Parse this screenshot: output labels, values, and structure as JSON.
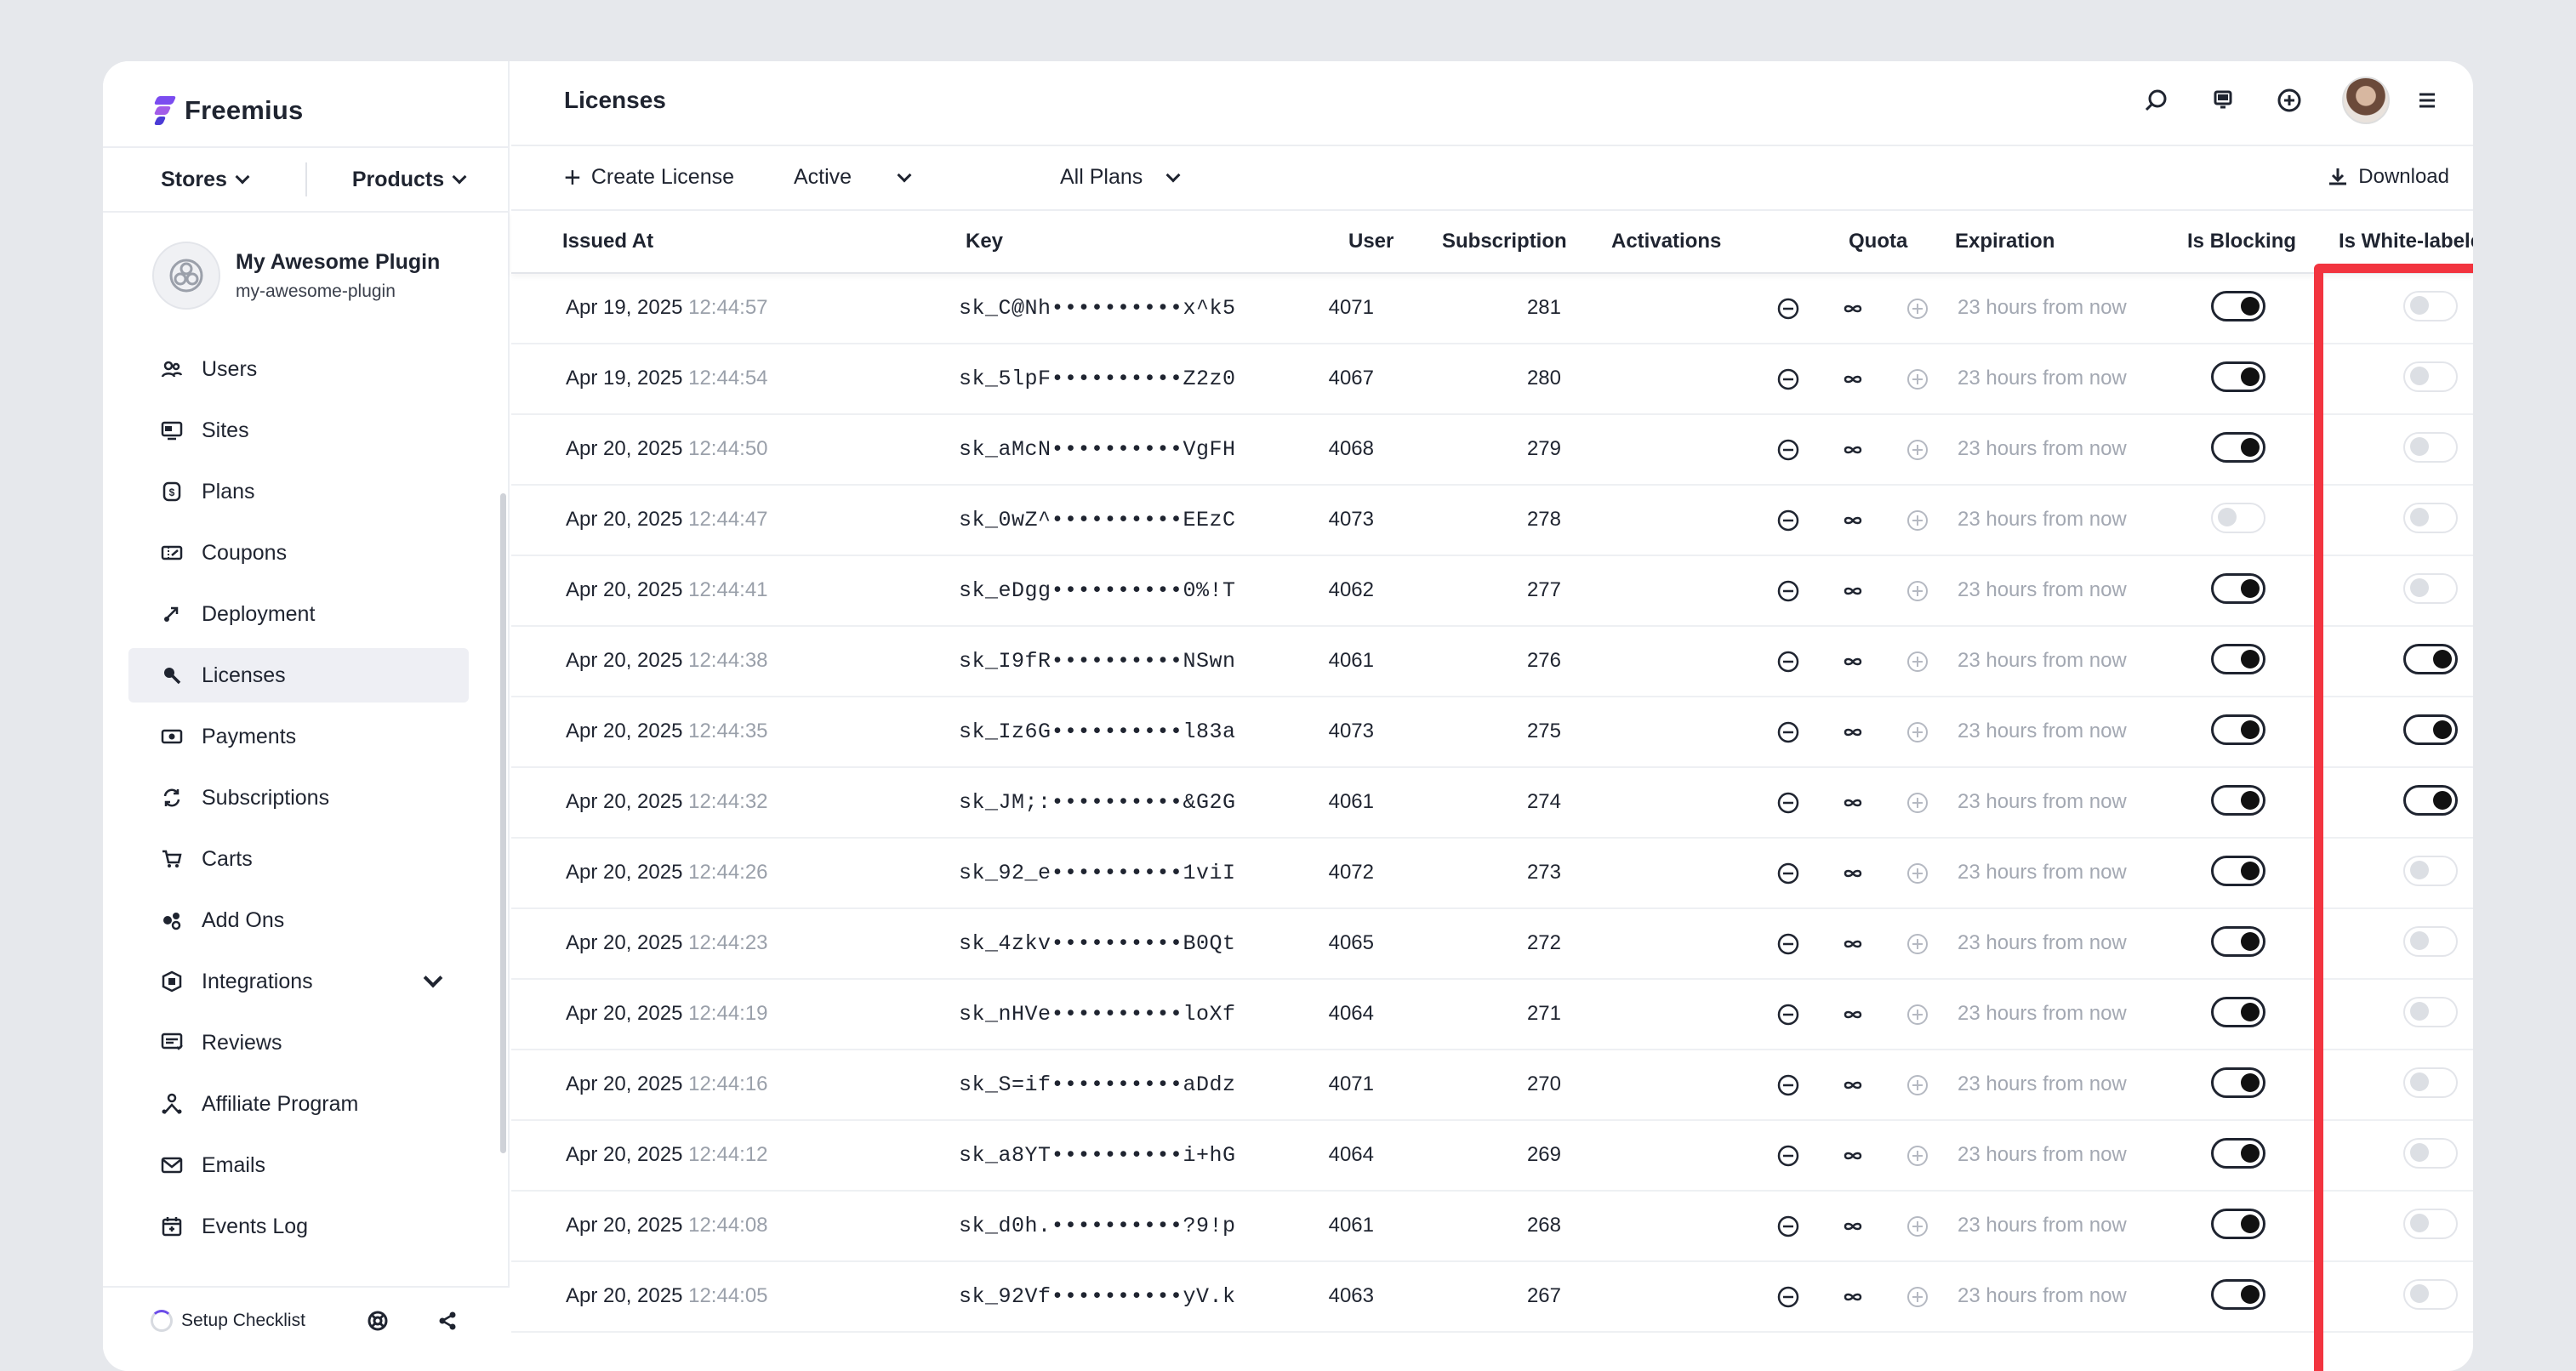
{
  "brand": {
    "name": "Freemius"
  },
  "switcher": {
    "stores": "Stores",
    "products": "Products"
  },
  "plugin": {
    "name": "My Awesome Plugin",
    "slug": "my-awesome-plugin"
  },
  "nav": {
    "items": [
      {
        "label": "Users",
        "icon": "users-icon"
      },
      {
        "label": "Sites",
        "icon": "sites-icon"
      },
      {
        "label": "Plans",
        "icon": "plans-icon"
      },
      {
        "label": "Coupons",
        "icon": "coupons-icon"
      },
      {
        "label": "Deployment",
        "icon": "deployment-icon"
      },
      {
        "label": "Licenses",
        "icon": "licenses-icon",
        "active": true
      },
      {
        "label": "Payments",
        "icon": "payments-icon"
      },
      {
        "label": "Subscriptions",
        "icon": "subscriptions-icon"
      },
      {
        "label": "Carts",
        "icon": "carts-icon"
      },
      {
        "label": "Add Ons",
        "icon": "addons-icon"
      },
      {
        "label": "Integrations",
        "icon": "integrations-icon",
        "expandable": true
      },
      {
        "label": "Reviews",
        "icon": "reviews-icon"
      },
      {
        "label": "Affiliate Program",
        "icon": "affiliate-icon"
      },
      {
        "label": "Emails",
        "icon": "emails-icon"
      },
      {
        "label": "Events Log",
        "icon": "events-log-icon"
      }
    ]
  },
  "footer": {
    "setup": "Setup Checklist"
  },
  "page": {
    "title": "Licenses"
  },
  "toolbar": {
    "create": "Create License",
    "status": "Active",
    "plans": "All Plans",
    "download": "Download"
  },
  "table": {
    "columns": {
      "issued_at": "Issued At",
      "key": "Key",
      "user": "User",
      "subscription": "Subscription",
      "activations": "Activations",
      "quota": "Quota",
      "expiration": "Expiration",
      "is_blocking": "Is Blocking",
      "is_white_labeled": "Is White-labeled"
    },
    "rows": [
      {
        "date": "Apr 19, 2025",
        "time": "12:44:57",
        "key": "sk_C@Nh••••••••••x^k5",
        "user": "4071",
        "subscription": "281",
        "expiration": "23 hours from now",
        "blocking": true,
        "white_labeled": false
      },
      {
        "date": "Apr 19, 2025",
        "time": "12:44:54",
        "key": "sk_5lpF••••••••••Z2z0",
        "user": "4067",
        "subscription": "280",
        "expiration": "23 hours from now",
        "blocking": true,
        "white_labeled": false
      },
      {
        "date": "Apr 20, 2025",
        "time": "12:44:50",
        "key": "sk_aMcN••••••••••VgFH",
        "user": "4068",
        "subscription": "279",
        "expiration": "23 hours from now",
        "blocking": true,
        "white_labeled": false
      },
      {
        "date": "Apr 20, 2025",
        "time": "12:44:47",
        "key": "sk_0wZ^••••••••••EEzC",
        "user": "4073",
        "subscription": "278",
        "expiration": "23 hours from now",
        "blocking": false,
        "white_labeled": false
      },
      {
        "date": "Apr 20, 2025",
        "time": "12:44:41",
        "key": "sk_eDgg••••••••••0%!T",
        "user": "4062",
        "subscription": "277",
        "expiration": "23 hours from now",
        "blocking": true,
        "white_labeled": false
      },
      {
        "date": "Apr 20, 2025",
        "time": "12:44:38",
        "key": "sk_I9fR••••••••••NSwn",
        "user": "4061",
        "subscription": "276",
        "expiration": "23 hours from now",
        "blocking": true,
        "white_labeled": true
      },
      {
        "date": "Apr 20, 2025",
        "time": "12:44:35",
        "key": "sk_Iz6G••••••••••l83a",
        "user": "4073",
        "subscription": "275",
        "expiration": "23 hours from now",
        "blocking": true,
        "white_labeled": true
      },
      {
        "date": "Apr 20, 2025",
        "time": "12:44:32",
        "key": "sk_JM;:••••••••••&G2G",
        "user": "4061",
        "subscription": "274",
        "expiration": "23 hours from now",
        "blocking": true,
        "white_labeled": true
      },
      {
        "date": "Apr 20, 2025",
        "time": "12:44:26",
        "key": "sk_92_e••••••••••1viI",
        "user": "4072",
        "subscription": "273",
        "expiration": "23 hours from now",
        "blocking": true,
        "white_labeled": false
      },
      {
        "date": "Apr 20, 2025",
        "time": "12:44:23",
        "key": "sk_4zkv••••••••••B0Qt",
        "user": "4065",
        "subscription": "272",
        "expiration": "23 hours from now",
        "blocking": true,
        "white_labeled": false
      },
      {
        "date": "Apr 20, 2025",
        "time": "12:44:19",
        "key": "sk_nHVe••••••••••loXf",
        "user": "4064",
        "subscription": "271",
        "expiration": "23 hours from now",
        "blocking": true,
        "white_labeled": false
      },
      {
        "date": "Apr 20, 2025",
        "time": "12:44:16",
        "key": "sk_S=if••••••••••aDdz",
        "user": "4071",
        "subscription": "270",
        "expiration": "23 hours from now",
        "blocking": true,
        "white_labeled": false
      },
      {
        "date": "Apr 20, 2025",
        "time": "12:44:12",
        "key": "sk_a8YT••••••••••i+hG",
        "user": "4064",
        "subscription": "269",
        "expiration": "23 hours from now",
        "blocking": true,
        "white_labeled": false
      },
      {
        "date": "Apr 20, 2025",
        "time": "12:44:08",
        "key": "sk_d0h.••••••••••?9!p",
        "user": "4061",
        "subscription": "268",
        "expiration": "23 hours from now",
        "blocking": true,
        "white_labeled": false
      },
      {
        "date": "Apr 20, 2025",
        "time": "12:44:05",
        "key": "sk_92Vf••••••••••yV.k",
        "user": "4063",
        "subscription": "267",
        "expiration": "23 hours from now",
        "blocking": true,
        "white_labeled": false
      }
    ]
  },
  "colors": {
    "highlight": "#f2343f",
    "brand": "#7b4cf0"
  }
}
